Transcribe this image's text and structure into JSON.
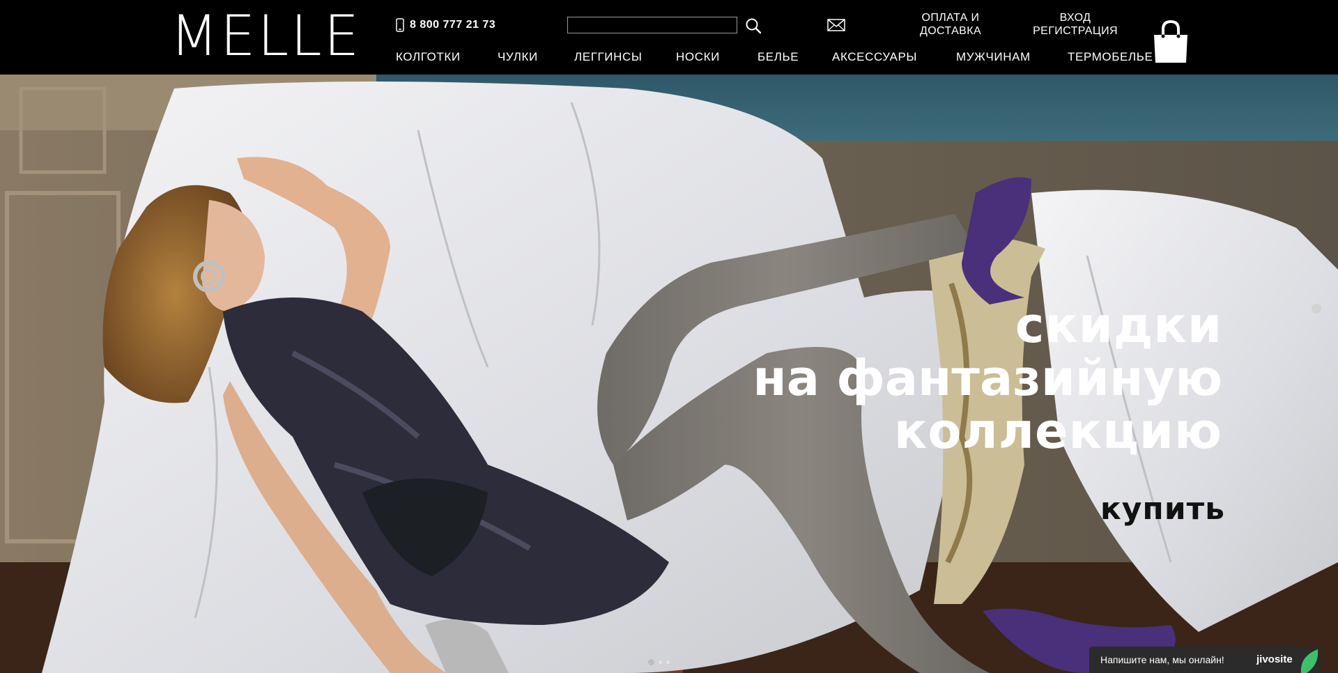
{
  "header": {
    "logo": "MELLE",
    "phone": "8 800 777 21 73",
    "search": {
      "value": "",
      "placeholder": ""
    },
    "shipping": {
      "line1": "ОПЛАТА И",
      "line2": "ДОСТАВКА"
    },
    "account": {
      "login": "ВХОД",
      "register": "РЕГИСТРАЦИЯ"
    },
    "icons": [
      "phone-icon",
      "search-icon",
      "mail-icon",
      "shopping-bag-icon"
    ]
  },
  "nav": {
    "items": [
      {
        "label": "КОЛГОТКИ"
      },
      {
        "label": "ЧУЛКИ"
      },
      {
        "label": "ЛЕГГИНСЫ"
      },
      {
        "label": "НОСКИ"
      },
      {
        "label": "БЕЛЬЕ"
      },
      {
        "label": "АКСЕССУАРЫ"
      },
      {
        "label": "МУЖЧИНАМ"
      },
      {
        "label": "ТЕРМОБЕЛЬЕ"
      }
    ]
  },
  "hero": {
    "line1": "скидки",
    "line2": "на фантазийную",
    "line3": "коллекцию",
    "cta": "купить",
    "slide_count": 3,
    "active_slide": 1
  },
  "chat": {
    "text": "Напишите нам, мы онлайн!",
    "brand": "jivosite"
  },
  "colors": {
    "header_bg": "#000000",
    "header_text": "#ffffff",
    "promo_text": "#ffffff",
    "cta_text": "#111111",
    "chat_bg": "#2b2b2b",
    "chat_accent": "#3ec06a"
  }
}
